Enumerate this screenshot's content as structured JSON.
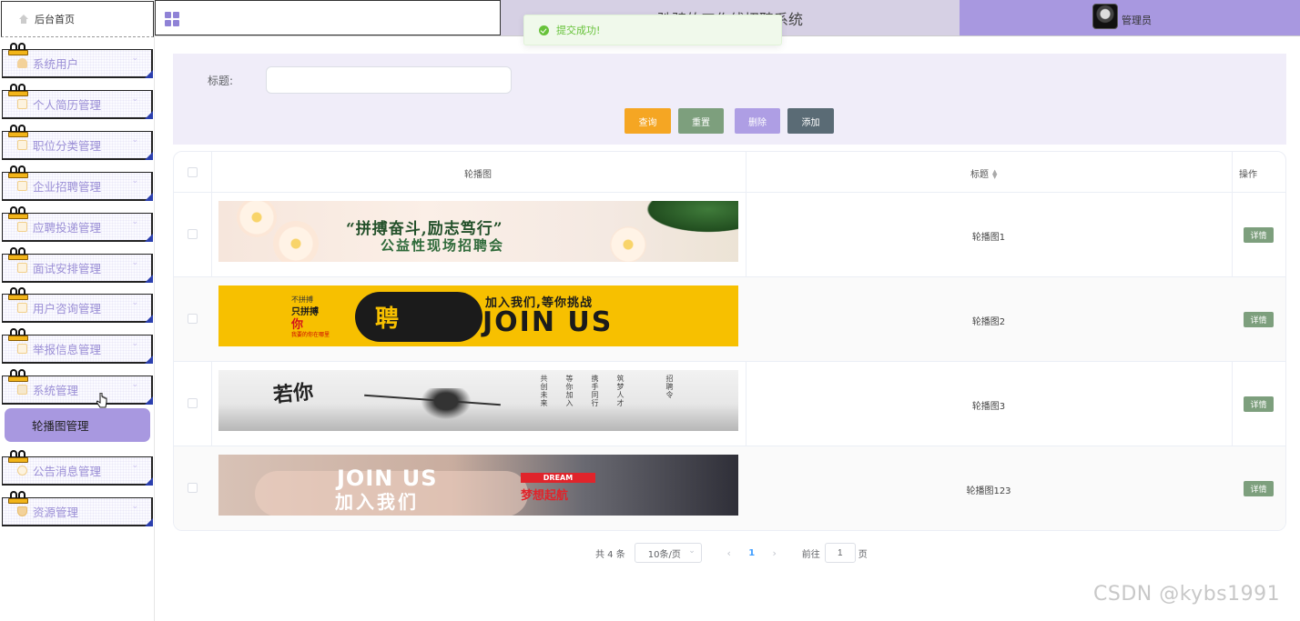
{
  "sidebar": {
    "home_label": "后台首页",
    "items": [
      {
        "label": "系统用户",
        "icon": "user-icon"
      },
      {
        "label": "个人简历管理",
        "icon": "document-icon"
      },
      {
        "label": "职位分类管理",
        "icon": "document-icon"
      },
      {
        "label": "企业招聘管理",
        "icon": "document-icon"
      },
      {
        "label": "应聘投递管理",
        "icon": "document-icon"
      },
      {
        "label": "面试安排管理",
        "icon": "document-icon"
      },
      {
        "label": "用户咨询管理",
        "icon": "document-icon"
      },
      {
        "label": "举报信息管理",
        "icon": "document-icon"
      },
      {
        "label": "系统管理",
        "icon": "settings-icon"
      },
      {
        "label": "公告消息管理",
        "icon": "info-icon"
      },
      {
        "label": "资源管理",
        "icon": "shield-icon"
      }
    ],
    "active_sub_item": "轮播图管理"
  },
  "header": {
    "system_title": "驰骋的工作线招聘系统",
    "user_label": "管理员"
  },
  "toast": {
    "message": "提交成功!"
  },
  "search": {
    "title_label": "标题:",
    "title_value": "",
    "buttons": {
      "query": "查询",
      "reset": "重置",
      "delete": "删除",
      "add": "添加"
    }
  },
  "table": {
    "columns": {
      "image": "轮播图",
      "title": "标题",
      "action": "操作"
    },
    "detail_label": "详情",
    "rows": [
      {
        "title": "轮播图1",
        "banner": {
          "line1": "“拼搏奋斗,励志笃行”",
          "line2": "公益性现场招聘会"
        }
      },
      {
        "title": "轮播图2",
        "banner": {
          "badge": "聘",
          "subtitle": "加入我们,等你挑战",
          "headline": "JOIN US",
          "small1": "不拼搏",
          "small2": "只拼搏",
          "accent": "你",
          "tiny": "我要的你在哪里"
        }
      },
      {
        "title": "轮播图3",
        "banner": {
          "calligraphy": "若你",
          "verses": [
            "共创未来",
            "等你加入",
            "携手同行",
            "筑梦人才",
            "招聘令"
          ]
        }
      },
      {
        "title": "轮播图123",
        "banner": {
          "headline": "JOIN US",
          "subline": "加入我们",
          "tag": "DREAM",
          "tag_text": "梦想起航"
        }
      }
    ]
  },
  "pagination": {
    "total": "共 4 条",
    "page_size": "10条/页",
    "current_page": "1",
    "goto_prefix": "前往",
    "goto_value": "1",
    "goto_suffix": "页"
  },
  "watermark": "CSDN @kybs1991",
  "colors": {
    "accent": "#a898e0",
    "query": "#f5a623",
    "reset": "#7d9f7d",
    "delete": "#ae9ee4",
    "add": "#5a6b75",
    "success": "#67c23a"
  }
}
